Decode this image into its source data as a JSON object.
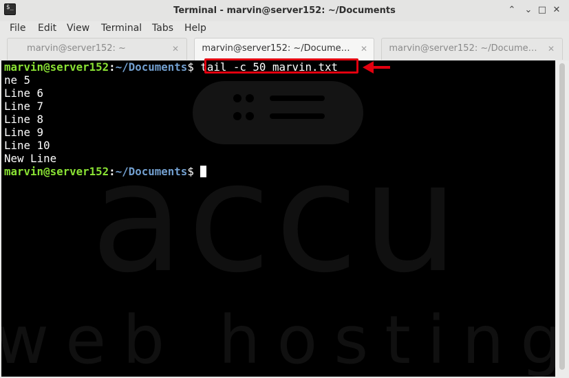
{
  "window": {
    "title": "Terminal - marvin@server152: ~/Documents",
    "app_icon_glyph": "$_",
    "controls": {
      "minimize": "⌃",
      "maximize": "⌄",
      "restore": "□",
      "close": "✕"
    }
  },
  "menu": {
    "items": [
      "File",
      "Edit",
      "View",
      "Terminal",
      "Tabs",
      "Help"
    ]
  },
  "tabs": [
    {
      "label": "marvin@server152: ~",
      "active": false,
      "close": "✕"
    },
    {
      "label": "marvin@server152: ~/Docume…",
      "active": true,
      "close": "✕"
    },
    {
      "label": "marvin@server152: ~/Docume…",
      "active": false,
      "close": "✕"
    }
  ],
  "terminal": {
    "prompt_user": "marvin@server152",
    "prompt_sep": ":",
    "prompt_path": "~/Documents",
    "prompt_dollar": "$",
    "command": " tail -c 50 marvin.txt",
    "output": [
      "ne 5",
      "Line 6",
      "Line 7",
      "Line 8",
      "Line 9",
      "Line 10",
      "New Line"
    ],
    "background": "#000000",
    "prompt_user_color": "#8ae234",
    "prompt_path_color": "#729fcf"
  },
  "watermark": {
    "brand": "accu",
    "tagline": "web hosting"
  },
  "annotation": {
    "highlight_color": "#e3000f"
  }
}
